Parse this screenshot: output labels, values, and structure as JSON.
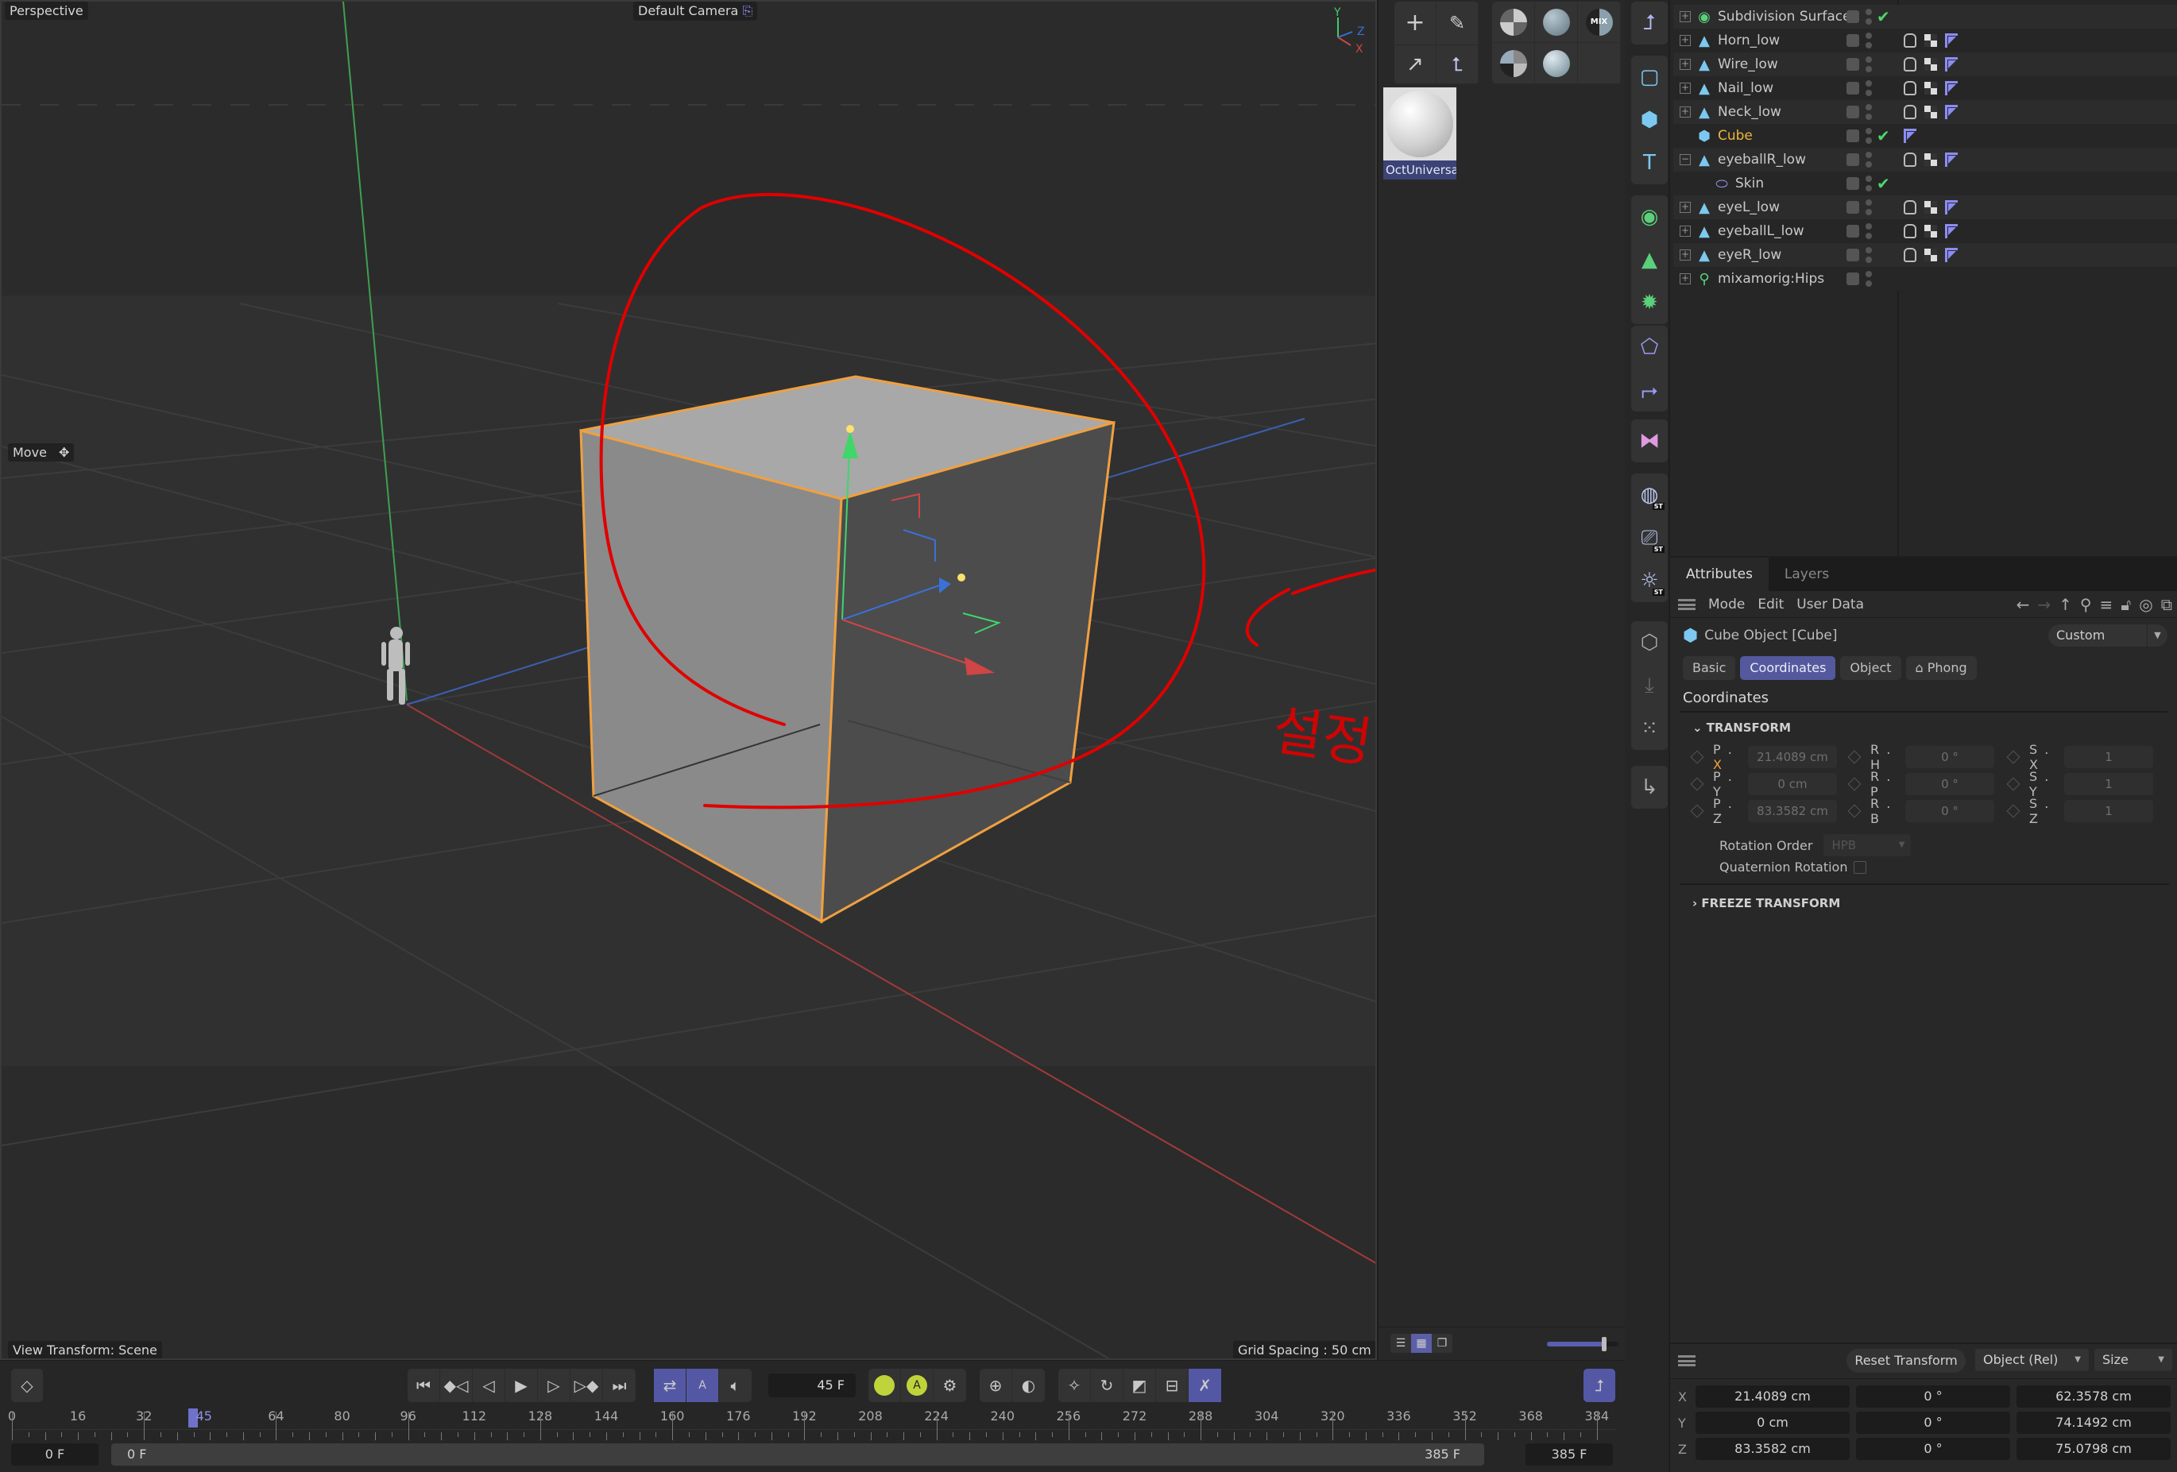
{
  "viewport": {
    "camera_mode": "Perspective",
    "camera_name": "Default Camera",
    "tool_label": "Move",
    "view_transform": "View Transform: Scene",
    "grid_spacing": "Grid Spacing : 50 cm",
    "axis_labels": {
      "y": "Y",
      "z": "Z",
      "x": "X"
    },
    "annotation_text": "설정 안됨",
    "colors": {
      "selection_outline": "#f0a040",
      "annotation": "#e00000",
      "axis_x": "#d04545",
      "axis_y": "#3fcc6a",
      "axis_z": "#3b6fd4"
    }
  },
  "materials": {
    "items": [
      {
        "name": "OctUniversal"
      }
    ],
    "preview_zoom_fraction": 0.8
  },
  "objects": {
    "rows": [
      {
        "name": "Subdivision Surface",
        "icon": "subdivision-icon",
        "expand": "+",
        "check": true,
        "tags": false
      },
      {
        "name": "Horn_low",
        "icon": "polygon-object-icon",
        "expand": "+",
        "check": false,
        "tags": true
      },
      {
        "name": "Wire_low",
        "icon": "polygon-object-icon",
        "expand": "+",
        "check": false,
        "tags": true
      },
      {
        "name": "Nail_low",
        "icon": "polygon-object-icon",
        "expand": "+",
        "check": false,
        "tags": true
      },
      {
        "name": "Neck_low",
        "icon": "polygon-object-icon",
        "expand": "+",
        "check": false,
        "tags": true
      },
      {
        "name": "Cube",
        "icon": "cube-icon",
        "expand": "",
        "check": true,
        "tags": "flag",
        "selected": true
      },
      {
        "name": "eyeballR_low",
        "icon": "polygon-object-icon",
        "expand": "−",
        "check": false,
        "tags": true
      },
      {
        "name": "Skin",
        "icon": "skin-icon",
        "expand": "",
        "check": true,
        "tags": false,
        "child": true
      },
      {
        "name": "eyeL_low",
        "icon": "polygon-object-icon",
        "expand": "+",
        "check": false,
        "tags": true
      },
      {
        "name": "eyeballL_low",
        "icon": "polygon-object-icon",
        "expand": "+",
        "check": false,
        "tags": true
      },
      {
        "name": "eyeR_low",
        "icon": "polygon-object-icon",
        "expand": "+",
        "check": false,
        "tags": true
      },
      {
        "name": "mixamorig:Hips",
        "icon": "joint-icon",
        "expand": "+",
        "check": false,
        "tags": false
      }
    ]
  },
  "attributes": {
    "tabs": [
      "Attributes",
      "Layers"
    ],
    "menu": [
      "Mode",
      "Edit",
      "User Data"
    ],
    "object_title": "Cube Object [Cube]",
    "layout_preset": "Custom",
    "subtabs": [
      "Basic",
      "Coordinates",
      "Object",
      "Phong"
    ],
    "active_subtab": "Coordinates",
    "section": "Coordinates",
    "transform_group": "TRANSFORM",
    "position": {
      "x_label": "P . X",
      "y_label": "P . Y",
      "z_label": "P . Z",
      "x": "21.4089 cm",
      "y": "0 cm",
      "z": "83.3582 cm"
    },
    "rotation": {
      "h_label": "R . H",
      "p_label": "R . P",
      "b_label": "R . B",
      "h": "0 °",
      "p": "0 °",
      "b": "0 °"
    },
    "scale": {
      "x_label": "S . X",
      "y_label": "S . Y",
      "z_label": "S . Z",
      "x": "1",
      "y": "1",
      "z": "1"
    },
    "rotation_order_label": "Rotation Order",
    "rotation_order_value": "HPB",
    "quaternion_label": "Quaternion Rotation",
    "quaternion_checked": false,
    "freeze_group": "FREEZE TRANSFORM"
  },
  "coordinates_manager": {
    "reset_button": "Reset Transform",
    "space_select": "Object (Rel)",
    "mode_select": "Size",
    "rows": [
      {
        "axis": "X",
        "position": "21.4089 cm",
        "rotation": "0 °",
        "size": "62.3578 cm"
      },
      {
        "axis": "Y",
        "position": "0 cm",
        "rotation": "0 °",
        "size": "74.1492 cm"
      },
      {
        "axis": "Z",
        "position": "83.3582 cm",
        "rotation": "0 °",
        "size": "75.0798 cm"
      }
    ]
  },
  "timeline": {
    "current_frame": "45 F",
    "current_frame_number": 45,
    "ruler_ticks": [
      0,
      16,
      32,
      64,
      80,
      96,
      112,
      128,
      144,
      160,
      176,
      192,
      208,
      224,
      240,
      256,
      272,
      288,
      304,
      320,
      336,
      352,
      368,
      384
    ],
    "ruler_max": 385,
    "start_frame": "0 F",
    "range_start": "0 F",
    "range_end": "385 F",
    "end_frame": "385 F",
    "transport_buttons": [
      "go-to-start",
      "previous-key",
      "previous-frame",
      "play",
      "next-frame",
      "next-key",
      "go-to-end"
    ]
  }
}
